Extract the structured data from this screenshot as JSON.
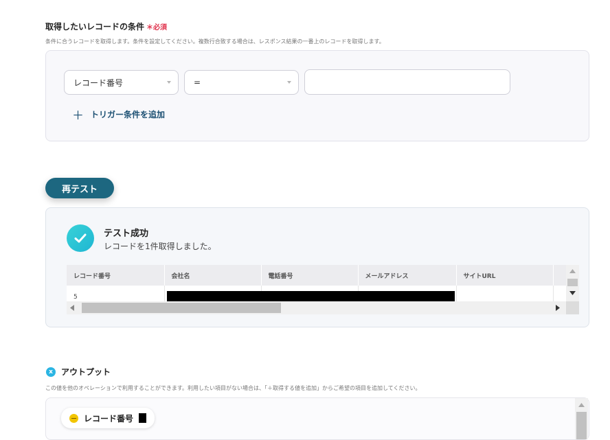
{
  "conditions": {
    "title": "取得したいレコードの条件",
    "required_mark": "＊",
    "required_label": "必須",
    "description": "条件に合うレコードを取得します。条件を設定してください。複数行合致する場合は、レスポンス結果の一番上のレコードを取得します。",
    "field_select": "レコード番号",
    "operator_select": "=",
    "value_input": "",
    "add_trigger_plus": "＋",
    "add_trigger_label": "トリガー条件を追加"
  },
  "retest": {
    "label": "再テスト"
  },
  "result": {
    "title": "テスト成功",
    "subtitle": "レコードを1件取得しました。",
    "columns": [
      "レコード番号",
      "会社名",
      "電話番号",
      "メールアドレス",
      "サイトURL"
    ],
    "rows": [
      [
        "5",
        "",
        "",
        "",
        ""
      ]
    ]
  },
  "output": {
    "title": "アウトプット",
    "icon_letter": "x",
    "description": "この値を他のオペレーションで利用することができます。利用したい項目がない場合は、「＋取得する値を追加」からご希望の項目を追加してください。",
    "chip_label": "レコード番号"
  },
  "colors": {
    "accent": "#1d6780",
    "required": "#e0334d",
    "success": "#2bc8d8"
  }
}
